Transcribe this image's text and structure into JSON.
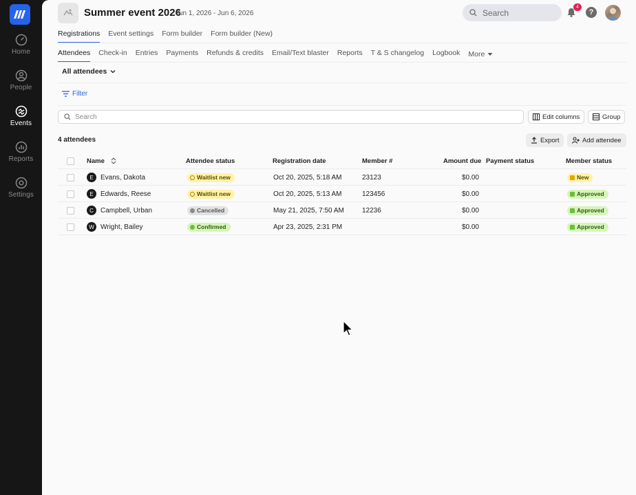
{
  "sidebar": {
    "logo": "app-logo",
    "items": [
      {
        "label": "Home",
        "icon": "gauge-icon",
        "active": false
      },
      {
        "label": "People",
        "icon": "person-icon",
        "active": false
      },
      {
        "label": "Events",
        "icon": "events-icon",
        "active": true
      },
      {
        "label": "Reports",
        "icon": "bar-chart-icon",
        "active": false
      },
      {
        "label": "Settings",
        "icon": "gear-icon",
        "active": false
      }
    ]
  },
  "header": {
    "title": "Summer event 2026",
    "dates": "Jun 1, 2026 - Jun 6, 2026",
    "search_placeholder": "Search",
    "notification_count": "4"
  },
  "tabs_primary": [
    "Registrations",
    "Event settings",
    "Form builder",
    "Form builder (New)"
  ],
  "tabs_secondary": [
    "Attendees",
    "Check-in",
    "Entries",
    "Payments",
    "Refunds & credits",
    "Email/Text blaster",
    "Reports",
    "T & S changelog",
    "Logbook"
  ],
  "more_label": "More",
  "view_select": "All attendees",
  "filter_label": "Filter",
  "table_search_placeholder": "Search",
  "buttons": {
    "edit_columns": "Edit columns",
    "group": "Group",
    "export": "Export",
    "add_attendee": "Add attendee"
  },
  "attendee_count": "4 attendees",
  "columns": {
    "name": "Name",
    "attendee_status": "Attendee status",
    "registration_date": "Registration date",
    "member_number": "Member #",
    "amount_due": "Amount due",
    "payment_status": "Payment status",
    "member_status": "Member status"
  },
  "rows": [
    {
      "initial": "E",
      "name": "Evans, Dakota",
      "status": "Waitlist new",
      "status_type": "waitlist",
      "date": "Oct 20, 2025, 5:18 AM",
      "member": "23123",
      "amount": "$0.00",
      "payment": "",
      "member_status": "New",
      "member_status_type": "new"
    },
    {
      "initial": "E",
      "name": "Edwards, Reese",
      "status": "Waitlist new",
      "status_type": "waitlist",
      "date": "Oct 20, 2025, 5:13 AM",
      "member": "123456",
      "amount": "$0.00",
      "payment": "",
      "member_status": "Approved",
      "member_status_type": "approved"
    },
    {
      "initial": "C",
      "name": "Campbell, Urban",
      "status": "Cancelled",
      "status_type": "cancelled",
      "date": "May 21, 2025, 7:50 AM",
      "member": "12236",
      "amount": "$0.00",
      "payment": "",
      "member_status": "Approved",
      "member_status_type": "approved"
    },
    {
      "initial": "W",
      "name": "Wright, Bailey",
      "status": "Confirmed",
      "status_type": "confirmed",
      "date": "Apr 23, 2025, 2:31 PM",
      "member": "",
      "amount": "$0.00",
      "payment": "",
      "member_status": "Approved",
      "member_status_type": "approved"
    }
  ],
  "colors": {
    "accent": "#2563eb",
    "sidebar_bg": "#161616",
    "waitlist_bg": "#fff3a6",
    "confirmed_bg": "#d6f5b8",
    "cancelled_bg": "#e2e2e2",
    "badge": "#e0244e"
  }
}
